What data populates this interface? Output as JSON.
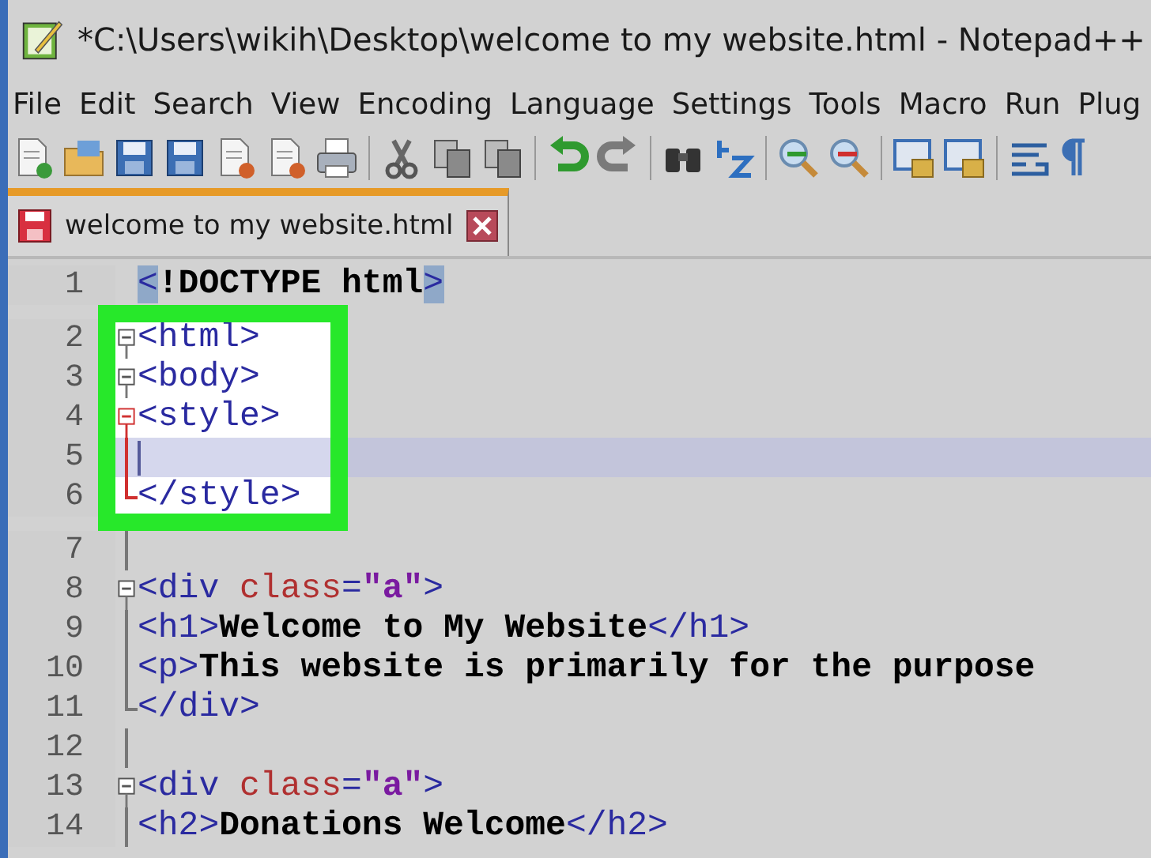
{
  "window": {
    "title": "*C:\\Users\\wikih\\Desktop\\welcome to my website.html - Notepad++"
  },
  "menu": [
    "File",
    "Edit",
    "Search",
    "View",
    "Encoding",
    "Language",
    "Settings",
    "Tools",
    "Macro",
    "Run",
    "Plug"
  ],
  "tabs": [
    {
      "label": "welcome to my website.html",
      "selected": true,
      "modified": true
    }
  ],
  "editor": {
    "lines": [
      {
        "number": "1",
        "kind": "plain",
        "selected": false,
        "highlighted": false,
        "tokens": [
          {
            "t": "<",
            "kind": "match"
          },
          {
            "t": "!DOCTYPE html",
            "kind": "text"
          },
          {
            "t": ">",
            "kind": "match"
          }
        ]
      },
      {
        "number": "2",
        "kind": "fold_start",
        "fold_current": false,
        "selected": false,
        "highlighted": true,
        "tokens": [
          {
            "t": "<html>",
            "kind": "tag"
          }
        ]
      },
      {
        "number": "3",
        "kind": "fold_start",
        "fold_current": false,
        "selected": false,
        "highlighted": true,
        "tokens": [
          {
            "t": "<body>",
            "kind": "tag"
          }
        ]
      },
      {
        "number": "4",
        "kind": "fold_start",
        "fold_current": true,
        "selected": false,
        "highlighted": true,
        "tokens": [
          {
            "t": "<style>",
            "kind": "tag"
          }
        ]
      },
      {
        "number": "5",
        "kind": "fold_body",
        "fold_current": true,
        "selected": true,
        "highlighted": true
      },
      {
        "number": "6",
        "kind": "fold_end",
        "fold_current": true,
        "selected": false,
        "highlighted": true,
        "tokens": [
          {
            "t": "</style>",
            "kind": "tag"
          }
        ]
      },
      {
        "number": "7",
        "kind": "fold_body",
        "fold_current": false,
        "selected": false,
        "highlighted": false
      },
      {
        "number": "8",
        "kind": "fold_start",
        "fold_current": false,
        "selected": false,
        "highlighted": false,
        "tokens": [
          {
            "t": "<div",
            "kind": "tag"
          },
          {
            "t": " class",
            "kind": "attr"
          },
          {
            "t": "=",
            "kind": "tag"
          },
          {
            "t": "\"a\"",
            "kind": "string"
          },
          {
            "t": ">",
            "kind": "tag"
          }
        ]
      },
      {
        "number": "9",
        "kind": "fold_body",
        "fold_current": false,
        "selected": false,
        "highlighted": false,
        "tokens": [
          {
            "t": "<h1>",
            "kind": "tag"
          },
          {
            "t": "Welcome to My Website",
            "kind": "text"
          },
          {
            "t": "</h1>",
            "kind": "tag"
          }
        ]
      },
      {
        "number": "10",
        "kind": "fold_body",
        "fold_current": false,
        "selected": false,
        "highlighted": false,
        "tokens": [
          {
            "t": "<p>",
            "kind": "tag"
          },
          {
            "t": "This website is primarily for the purpose",
            "kind": "text"
          }
        ]
      },
      {
        "number": "11",
        "kind": "fold_end",
        "fold_current": false,
        "selected": false,
        "highlighted": false,
        "tokens": [
          {
            "t": "</div>",
            "kind": "tag"
          }
        ]
      },
      {
        "number": "12",
        "kind": "fold_body",
        "fold_current": false,
        "selected": false,
        "highlighted": false
      },
      {
        "number": "13",
        "kind": "fold_start",
        "fold_current": false,
        "selected": false,
        "highlighted": false,
        "tokens": [
          {
            "t": "<div",
            "kind": "tag"
          },
          {
            "t": " class",
            "kind": "attr"
          },
          {
            "t": "=",
            "kind": "tag"
          },
          {
            "t": "\"a\"",
            "kind": "string"
          },
          {
            "t": ">",
            "kind": "tag"
          }
        ]
      },
      {
        "number": "14",
        "kind": "fold_body",
        "fold_current": false,
        "selected": false,
        "highlighted": false,
        "tokens": [
          {
            "t": "<h2>",
            "kind": "tag"
          },
          {
            "t": "Donations Welcome",
            "kind": "text"
          },
          {
            "t": "</h2>",
            "kind": "tag"
          }
        ]
      }
    ]
  }
}
